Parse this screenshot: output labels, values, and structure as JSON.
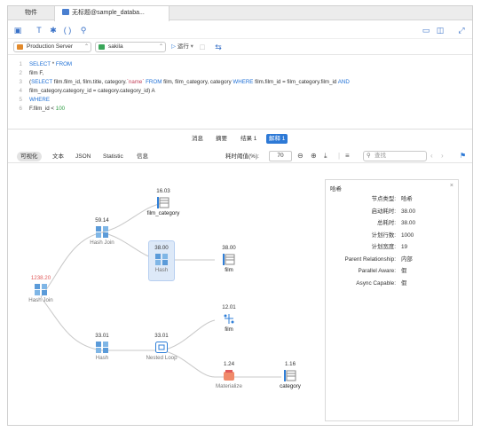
{
  "tabs": [
    {
      "label": "物件"
    },
    {
      "label": "无标题@sample_databa..."
    }
  ],
  "connection": {
    "server": "Production Server",
    "database": "sakila",
    "run_label": "运行"
  },
  "sql": [
    [
      "SELECT * FROM"
    ],
    [
      "film F,"
    ],
    [
      "(SELECT film.film_id, film.title, category.`name` FROM film, film_category, category WHERE film.film_id = film_category.film_id AND"
    ],
    [
      "film_category.category_id = category.category_id) A"
    ],
    [
      "WHERE"
    ],
    [
      "F.film_id < 100"
    ]
  ],
  "line_numbers": [
    "1",
    "2",
    "3",
    "4",
    "5",
    "6"
  ],
  "result_tabs": [
    "消息",
    "摘要",
    "结果 1",
    "解释 1"
  ],
  "view_tabs": [
    "可视化",
    "文本",
    "JSON",
    "Statistic",
    "信息"
  ],
  "threshold": {
    "label": "耗时阈值(%):",
    "value": "70"
  },
  "search": {
    "placeholder": "查找"
  },
  "nodes": {
    "hash_join_root": {
      "value": "1238.20",
      "label": "Hash Join"
    },
    "hash_join_inner": {
      "value": "59.14",
      "label": "Hash Join"
    },
    "film_category": {
      "value": "16.03",
      "label": "film_category"
    },
    "hash_selected": {
      "value": "38.00",
      "label": "Hash"
    },
    "film_1": {
      "value": "38.00",
      "label": "film"
    },
    "hash_2": {
      "value": "33.01",
      "label": "Hash"
    },
    "nested_loop": {
      "value": "33.01",
      "label": "Nested Loop"
    },
    "film_2": {
      "value": "12.01",
      "label": "film"
    },
    "materialize": {
      "value": "1.24",
      "label": "Materialize"
    },
    "category": {
      "value": "1.16",
      "label": "category"
    }
  },
  "detail": {
    "title": "哈希",
    "rows": [
      {
        "k": "节点类型:",
        "v": "哈希"
      },
      {
        "k": "启动耗时:",
        "v": "38.00"
      },
      {
        "k": "总耗时:",
        "v": "38.00"
      },
      {
        "k": "计划行数:",
        "v": "1000"
      },
      {
        "k": "计划宽度:",
        "v": "19"
      },
      {
        "k": "Parent Relationship:",
        "v": "内部"
      },
      {
        "k": "Parallel Aware:",
        "v": "假"
      },
      {
        "k": "Async Capable:",
        "v": "假"
      }
    ]
  },
  "colors": {
    "accent": "#2d79d6",
    "table_icon": "#2f7fd8",
    "warn": "#e05a5a"
  }
}
